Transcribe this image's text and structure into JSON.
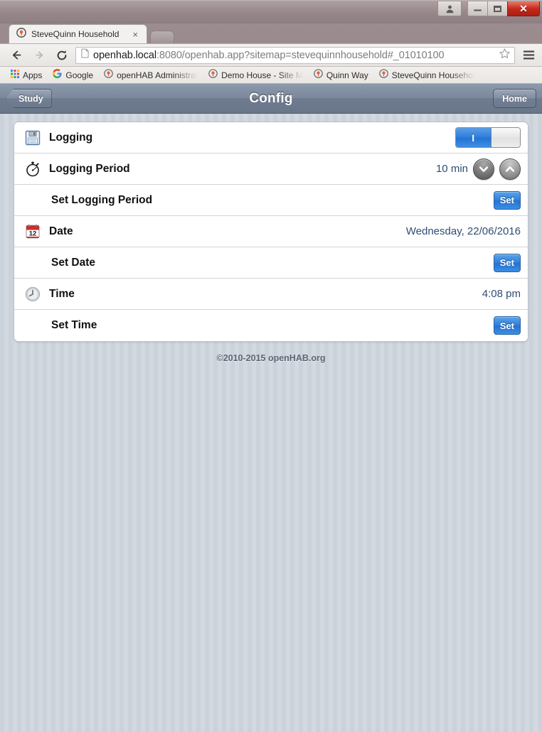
{
  "browser": {
    "tab": {
      "title": "SteveQuinn Household",
      "close_label": "×",
      "favicon": "openhab-icon"
    },
    "newtab_label": "",
    "nav": {
      "back": "←",
      "forward": "→",
      "reload": "⟳"
    },
    "url": {
      "host": "openhab.local",
      "rest": ":8080/openhab.app?sitemap=stevequinnhousehold#_01010100"
    },
    "bookmarks": [
      {
        "label": "Apps",
        "icon": "apps-grid-icon"
      },
      {
        "label": "Google",
        "icon": "google-icon"
      },
      {
        "label": "openHAB Administrat",
        "icon": "openhab-icon"
      },
      {
        "label": "Demo House - Site M",
        "icon": "openhab-icon"
      },
      {
        "label": "Quinn Way",
        "icon": "openhab-icon"
      },
      {
        "label": "SteveQuinn Househol",
        "icon": "openhab-icon"
      }
    ],
    "window_controls": {
      "user": "user-icon",
      "minimize": "minimize-icon",
      "maximize": "maximize-icon",
      "close": "✕"
    }
  },
  "app": {
    "header": {
      "back_label": "Study",
      "title": "Config",
      "home_label": "Home"
    },
    "rows": [
      {
        "name": "logging",
        "icon": "floppy-disk-icon",
        "label": "Logging",
        "control": "toggle",
        "toggle_on_label": "I",
        "toggle_state": "on"
      },
      {
        "name": "logging-period",
        "icon": "stopwatch-icon",
        "label": "Logging Period",
        "control": "stepper",
        "value": "10 min"
      },
      {
        "name": "set-logging-period",
        "icon": null,
        "label": "Set Logging Period",
        "control": "button",
        "button_label": "Set",
        "indent": true
      },
      {
        "name": "date",
        "icon": "calendar-icon",
        "icon_day": "12",
        "label": "Date",
        "control": "value",
        "value": "Wednesday, 22/06/2016"
      },
      {
        "name": "set-date",
        "icon": null,
        "label": "Set Date",
        "control": "button",
        "button_label": "Set",
        "indent": true
      },
      {
        "name": "time",
        "icon": "clock-icon",
        "label": "Time",
        "control": "value",
        "value": "4:08 pm"
      },
      {
        "name": "set-time",
        "icon": null,
        "label": "Set Time",
        "control": "button",
        "button_label": "Set",
        "indent": true
      }
    ],
    "footer": "©2010-2015 openHAB.org"
  },
  "colors": {
    "accent_blue": "#2f80dd",
    "header_blue_gray": "#7b889c",
    "value_text": "#2e4e73",
    "page_bg": "#cbd2da"
  }
}
